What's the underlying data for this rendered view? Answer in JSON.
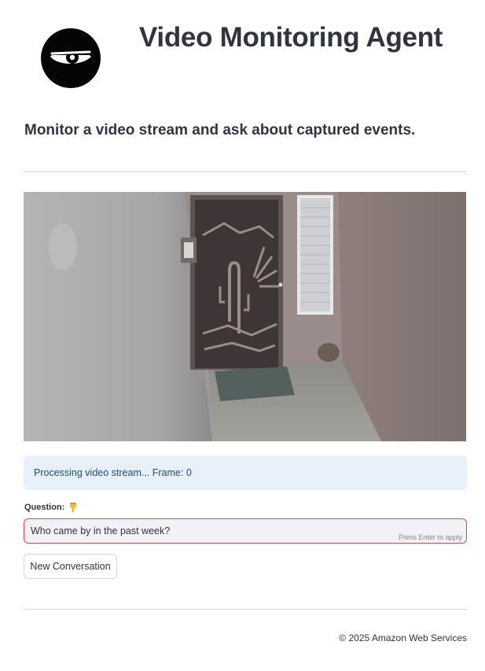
{
  "header": {
    "logo_icon": "eye-logo-icon",
    "title": "Video Monitoring Agent",
    "subtitle": "Monitor a video stream and ask about captured events."
  },
  "video": {
    "feed_icon": "camera-feed-image",
    "status_text": "Processing video stream... Frame: 0"
  },
  "question": {
    "label": "Question:",
    "label_icon": "pointing-down-hand-icon",
    "value": "Who came by in the past week?",
    "hint": "Press Enter to apply"
  },
  "actions": {
    "new_conversation_label": "New Conversation"
  },
  "footer": {
    "copyright": "© 2025 Amazon Web Services"
  },
  "colors": {
    "status_bg": "#e8f0fb",
    "status_text": "#1f4a82",
    "input_border_focus": "#e0475a",
    "input_bg": "#f0f2f6"
  }
}
